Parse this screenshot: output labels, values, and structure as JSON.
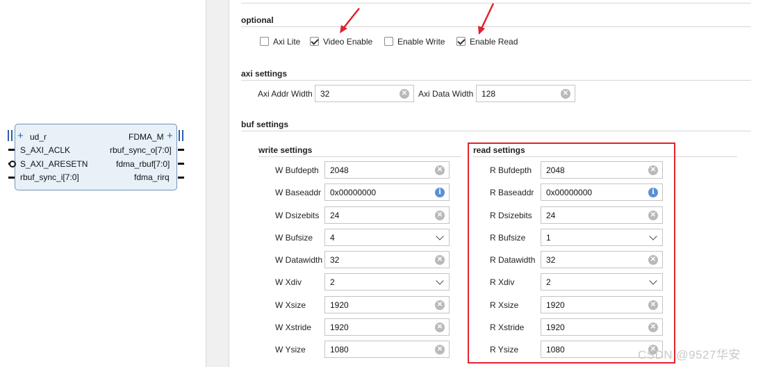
{
  "ip_block": {
    "left_pins": [
      {
        "label": "ud_r"
      },
      {
        "label": "S_AXI_ACLK"
      },
      {
        "label": "S_AXI_ARESETN"
      },
      {
        "label": "rbuf_sync_i[7:0]"
      }
    ],
    "right_pins": [
      {
        "label": "FDMA_M"
      },
      {
        "label": "rbuf_sync_o[7:0]"
      },
      {
        "label": "fdma_rbuf[7:0]"
      },
      {
        "label": "fdma_rirq"
      }
    ]
  },
  "optional": {
    "title": "optional",
    "checkboxes": [
      {
        "label": "Axi Lite",
        "checked": false
      },
      {
        "label": "Video Enable",
        "checked": true
      },
      {
        "label": "Enable Write",
        "checked": false
      },
      {
        "label": "Enable Read",
        "checked": true
      }
    ]
  },
  "axi_settings": {
    "title": "axi settings",
    "addr_label": "Axi Addr Width",
    "addr_value": "32",
    "data_label": "Axi Data Width",
    "data_value": "128"
  },
  "buf_settings": {
    "title": "buf settings"
  },
  "write_settings": {
    "title": "write settings",
    "rows": [
      {
        "label": "W Bufdepth",
        "value": "2048",
        "kind": "text"
      },
      {
        "label": "W Baseaddr",
        "value": "0x00000000",
        "kind": "info"
      },
      {
        "label": "W Dsizebits",
        "value": "24",
        "kind": "text"
      },
      {
        "label": "W Bufsize",
        "value": "4",
        "kind": "select"
      },
      {
        "label": "W Datawidth",
        "value": "32",
        "kind": "text"
      },
      {
        "label": "W Xdiv",
        "value": "2",
        "kind": "select"
      },
      {
        "label": "W Xsize",
        "value": "1920",
        "kind": "text"
      },
      {
        "label": "W Xstride",
        "value": "1920",
        "kind": "text"
      },
      {
        "label": "W Ysize",
        "value": "1080",
        "kind": "text"
      }
    ]
  },
  "read_settings": {
    "title": "read settings",
    "rows": [
      {
        "label": "R Bufdepth",
        "value": "2048",
        "kind": "text"
      },
      {
        "label": "R Baseaddr",
        "value": "0x00000000",
        "kind": "info"
      },
      {
        "label": "R Dsizebits",
        "value": "24",
        "kind": "text"
      },
      {
        "label": "R Bufsize",
        "value": "1",
        "kind": "select"
      },
      {
        "label": "R Datawidth",
        "value": "32",
        "kind": "text"
      },
      {
        "label": "R Xdiv",
        "value": "2",
        "kind": "select"
      },
      {
        "label": "R Xsize",
        "value": "1920",
        "kind": "text"
      },
      {
        "label": "R Xstride",
        "value": "1920",
        "kind": "text"
      },
      {
        "label": "R Ysize",
        "value": "1080",
        "kind": "text"
      }
    ]
  },
  "watermark": "CSDN @9527华安",
  "colors": {
    "highlight": "#e0232d",
    "block_fill": "#e8f1f8",
    "block_border": "#6f93b8"
  }
}
